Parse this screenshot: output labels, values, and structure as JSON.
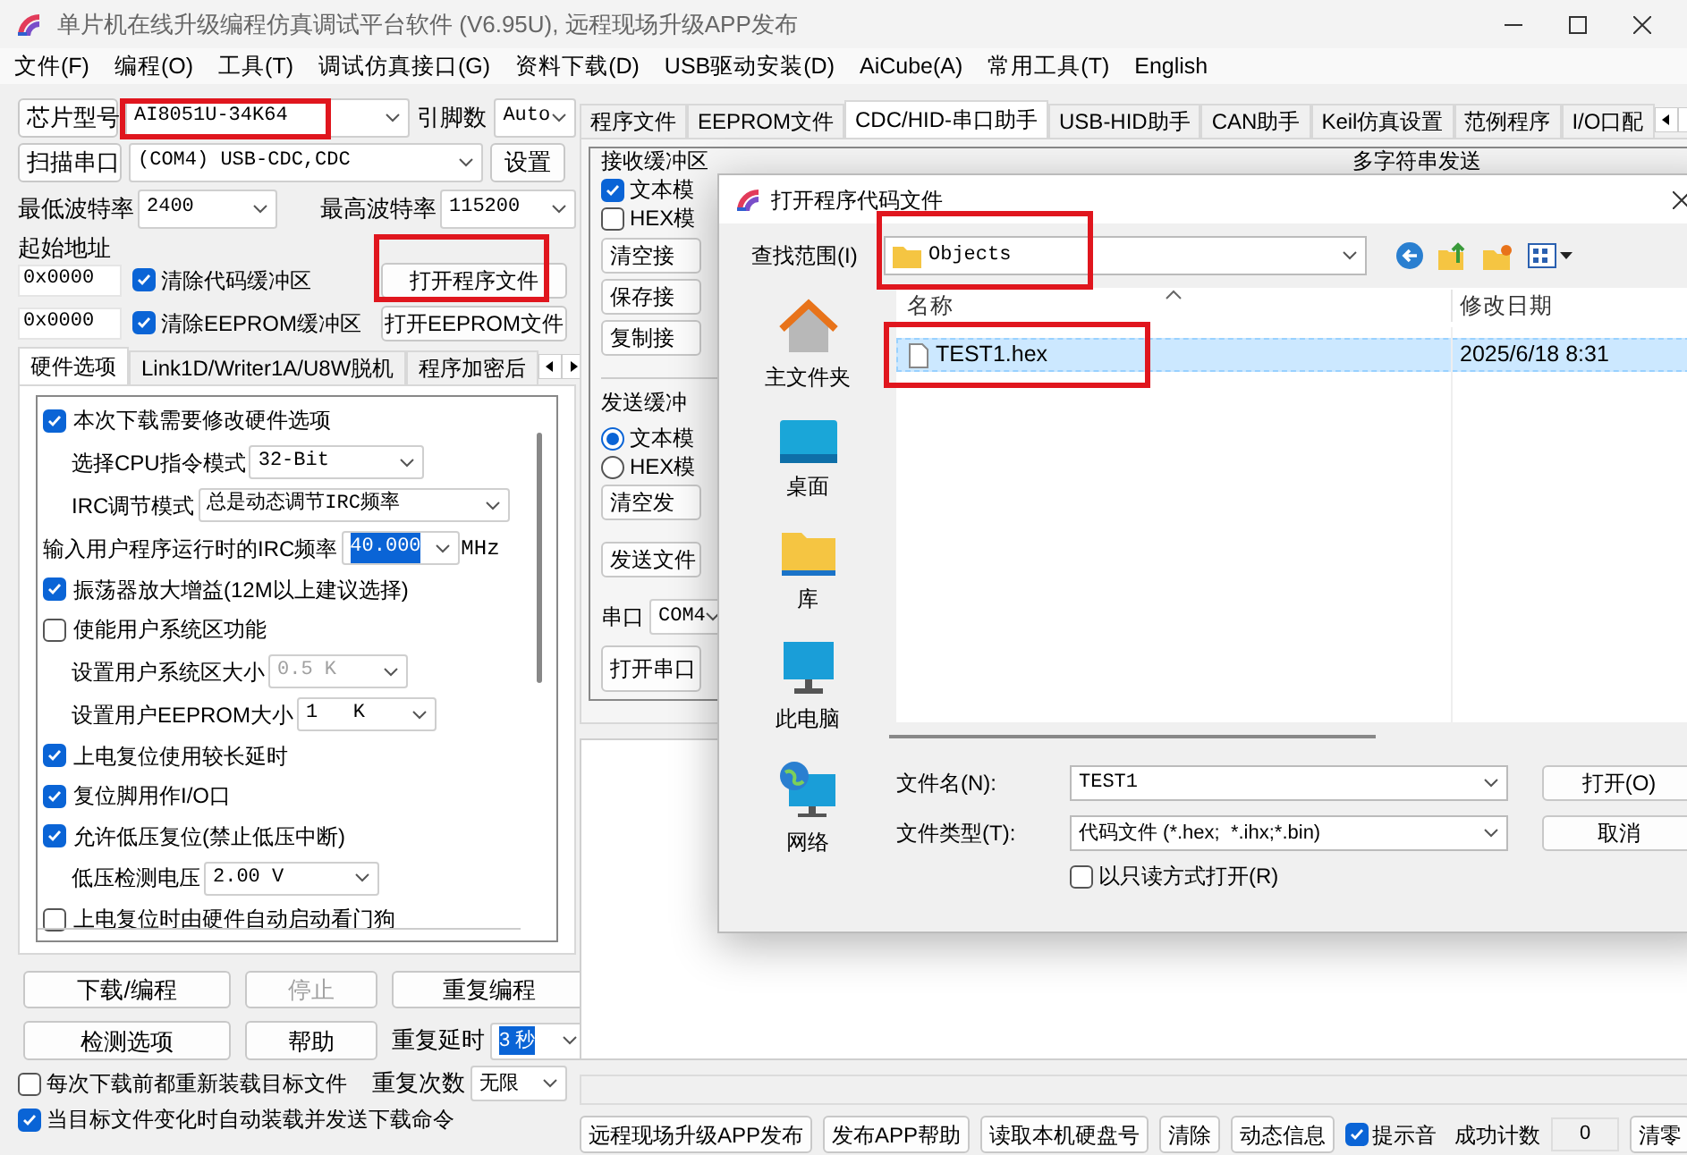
{
  "window": {
    "title": "单片机在线升级编程仿真调试平台软件 (V6.95U), 远程现场升级APP发布"
  },
  "menu": [
    "文件(F)",
    "编程(O)",
    "工具(T)",
    "调试仿真接口(G)",
    "资料下载(D)",
    "USB驱动安装(D)",
    "AiCube(A)",
    "常用工具(T)",
    "English"
  ],
  "chip": {
    "button": "芯片型号",
    "value": "AI8051U-34K64",
    "pins_label": "引脚数",
    "pins": "Auto"
  },
  "port": {
    "button": "扫描串口",
    "value": "(COM4) USB-CDC,CDC",
    "settings": "设置"
  },
  "baud": {
    "min_label": "最低波特率",
    "min": "2400",
    "max_label": "最高波特率",
    "max": "115200"
  },
  "address": {
    "label": "起始地址",
    "rows": [
      {
        "value": "0x0000",
        "check": "清除代码缓冲区",
        "checked": true,
        "button": "打开程序文件"
      },
      {
        "value": "0x0000",
        "check": "清除EEPROM缓冲区",
        "checked": true,
        "button": "打开EEPROM文件"
      }
    ]
  },
  "left_tabs": [
    {
      "label": "硬件选项",
      "selected": true
    },
    {
      "label": "Link1D/Writer1A/U8W脱机",
      "selected": false
    },
    {
      "label": "程序加密后",
      "selected": false
    }
  ],
  "options": [
    {
      "kind": "checkbox",
      "label": "本次下载需要修改硬件选项",
      "checked": true
    },
    {
      "kind": "select",
      "label": "选择CPU指令模式",
      "value": "32-Bit",
      "disabled": false,
      "highlighted": false
    },
    {
      "kind": "select",
      "label": "IRC调节模式",
      "value": "总是动态调节IRC频率",
      "disabled": false,
      "highlighted": false
    },
    {
      "kind": "select",
      "label": "输入用户程序运行时的IRC频率",
      "value": "40.000",
      "unit": "MHz",
      "disabled": false,
      "highlighted": true
    },
    {
      "kind": "checkbox",
      "label": "振荡器放大增益(12M以上建议选择)",
      "checked": true
    },
    {
      "kind": "checkbox",
      "label": "使能用户系统区功能",
      "checked": false
    },
    {
      "kind": "select",
      "label": "设置用户系统区大小",
      "value": "0.5 K",
      "disabled": true,
      "highlighted": false
    },
    {
      "kind": "select",
      "label": "设置用户EEPROM大小",
      "value": "1   K",
      "disabled": false,
      "highlighted": false
    },
    {
      "kind": "checkbox",
      "label": "上电复位使用较长延时",
      "checked": true
    },
    {
      "kind": "checkbox",
      "label": "复位脚用作I/O口",
      "checked": true
    },
    {
      "kind": "checkbox",
      "label": "允许低压复位(禁止低压中断)",
      "checked": true
    },
    {
      "kind": "select",
      "label": "低压检测电压",
      "value": "2.00 V",
      "disabled": false,
      "highlighted": false
    },
    {
      "kind": "checkbox",
      "label": "上电复位时由硬件自动启动看门狗",
      "checked": false
    }
  ],
  "actions": [
    {
      "label": "下载/编程",
      "disabled": false
    },
    {
      "label": "停止",
      "disabled": true
    },
    {
      "label": "重复编程",
      "disabled": false
    },
    {
      "label": "检测选项",
      "disabled": false
    },
    {
      "label": "帮助",
      "disabled": false
    }
  ],
  "repeat": {
    "delay_label": "重复延时",
    "delay": "3 秒",
    "delay_highlighted": true,
    "count_label": "重复次数",
    "count": "无限"
  },
  "bottom_checks": [
    {
      "label": "每次下载前都重新装载目标文件",
      "checked": false
    },
    {
      "label": "当目标文件变化时自动装载并发送下载命令",
      "checked": true
    }
  ],
  "right_tabs": [
    {
      "label": "程序文件",
      "selected": false
    },
    {
      "label": "EEPROM文件",
      "selected": false
    },
    {
      "label": "CDC/HID-串口助手",
      "selected": true
    },
    {
      "label": "USB-HID助手",
      "selected": false
    },
    {
      "label": "CAN助手",
      "selected": false
    },
    {
      "label": "Keil仿真设置",
      "selected": false
    },
    {
      "label": "范例程序",
      "selected": false
    },
    {
      "label": "I/O口配",
      "selected": false
    }
  ],
  "receive": {
    "title": "接收缓冲区",
    "modes": [
      {
        "label": "文本模",
        "checked": true
      },
      {
        "label": "HEX模",
        "checked": false
      }
    ],
    "buttons": [
      "清空接",
      "保存接",
      "复制接"
    ]
  },
  "multi_send_title": "多字符串发送",
  "send": {
    "title": "发送缓冲",
    "modes": [
      {
        "label": "文本模",
        "selected": true
      },
      {
        "label": "HEX模",
        "selected": false
      }
    ],
    "buttons": [
      "清空发",
      "发送文件"
    ]
  },
  "serial": {
    "label": "串口",
    "value": "COM4",
    "button": "打开串口"
  },
  "footer_buttons": [
    "远程现场升级APP发布",
    "发布APP帮助",
    "读取本机硬盘号",
    "清除",
    "动态信息"
  ],
  "beep": {
    "label": "提示音",
    "checked": true
  },
  "success": {
    "label": "成功计数",
    "value": "0",
    "button": "清零"
  },
  "dialog": {
    "title": "打开程序代码文件",
    "look_in_label": "查找范围(I)",
    "look_in": "Objects",
    "places": [
      {
        "kind": "home",
        "label": "主文件夹"
      },
      {
        "kind": "desktop",
        "label": "桌面"
      },
      {
        "kind": "library",
        "label": "库"
      },
      {
        "kind": "computer",
        "label": "此电脑"
      },
      {
        "kind": "network",
        "label": "网络"
      }
    ],
    "columns": [
      "名称",
      "修改日期"
    ],
    "files": [
      {
        "name": "TEST1.hex",
        "date": "2025/6/18 8:31",
        "selected": true
      }
    ],
    "filename_label": "文件名(N):",
    "filename": "TEST1",
    "filetype_label": "文件类型(T):",
    "filetype": "代码文件 (*.hex;  *.ihx;*.bin)",
    "readonly": {
      "label": "以只读方式打开(R)",
      "checked": false
    },
    "buttons": [
      "打开(O)",
      "取消"
    ]
  }
}
